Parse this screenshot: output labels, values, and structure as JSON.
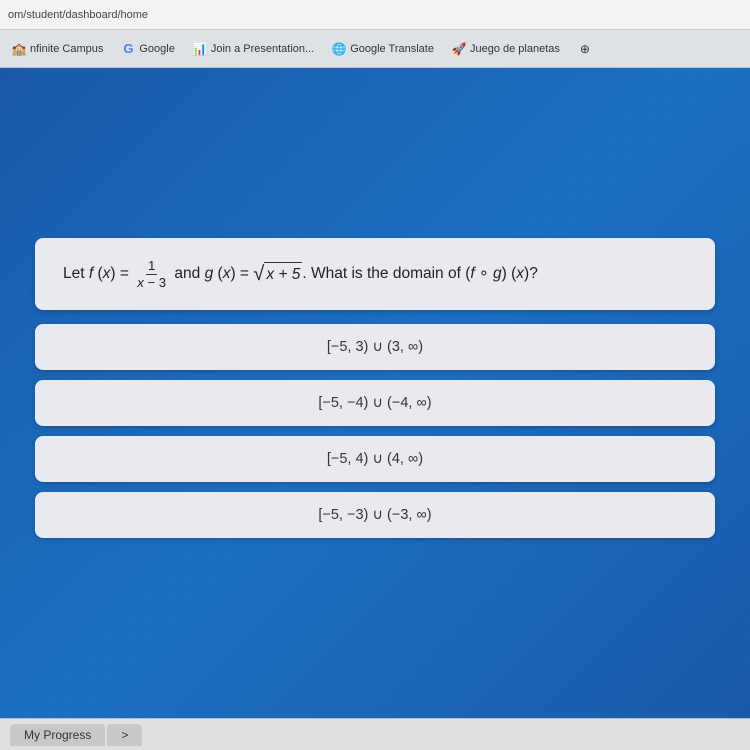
{
  "browser": {
    "url": "om/student/dashboard/home"
  },
  "tabs": [
    {
      "id": "infinite-campus",
      "label": "nfinite Campus",
      "icon": "🏫"
    },
    {
      "id": "google",
      "label": "Google",
      "icon": "G"
    },
    {
      "id": "join-presentation",
      "label": "Join a Presentation...",
      "icon": "📊"
    },
    {
      "id": "google-translate",
      "label": "Google Translate",
      "icon": "🌐"
    },
    {
      "id": "juego-planetas",
      "label": "Juego de planetas",
      "icon": "🚀"
    },
    {
      "id": "more",
      "label": "",
      "icon": "⊕"
    }
  ],
  "question": {
    "text_prefix": "Let ",
    "f_label": "f",
    "f_var": "x",
    "f_def": "1 / (x − 3)",
    "and": " and ",
    "g_label": "g",
    "g_var": "x",
    "g_def": "√(x + 5)",
    "suffix": ". What is the domain of (f ∘ g) (x)?"
  },
  "answers": [
    {
      "id": "a",
      "text": "[−5, 3) ∪ (3, ∞)"
    },
    {
      "id": "b",
      "text": "[−5, −4) ∪ (−4, ∞)"
    },
    {
      "id": "c",
      "text": "[−5, 4) ∪ (4, ∞)"
    },
    {
      "id": "d",
      "text": "[−5, −3) ∪ (−3, ∞)"
    }
  ],
  "bottom_tabs": [
    {
      "id": "my-progress",
      "label": "My Progress"
    },
    {
      "id": "arrow",
      "label": ">"
    }
  ]
}
